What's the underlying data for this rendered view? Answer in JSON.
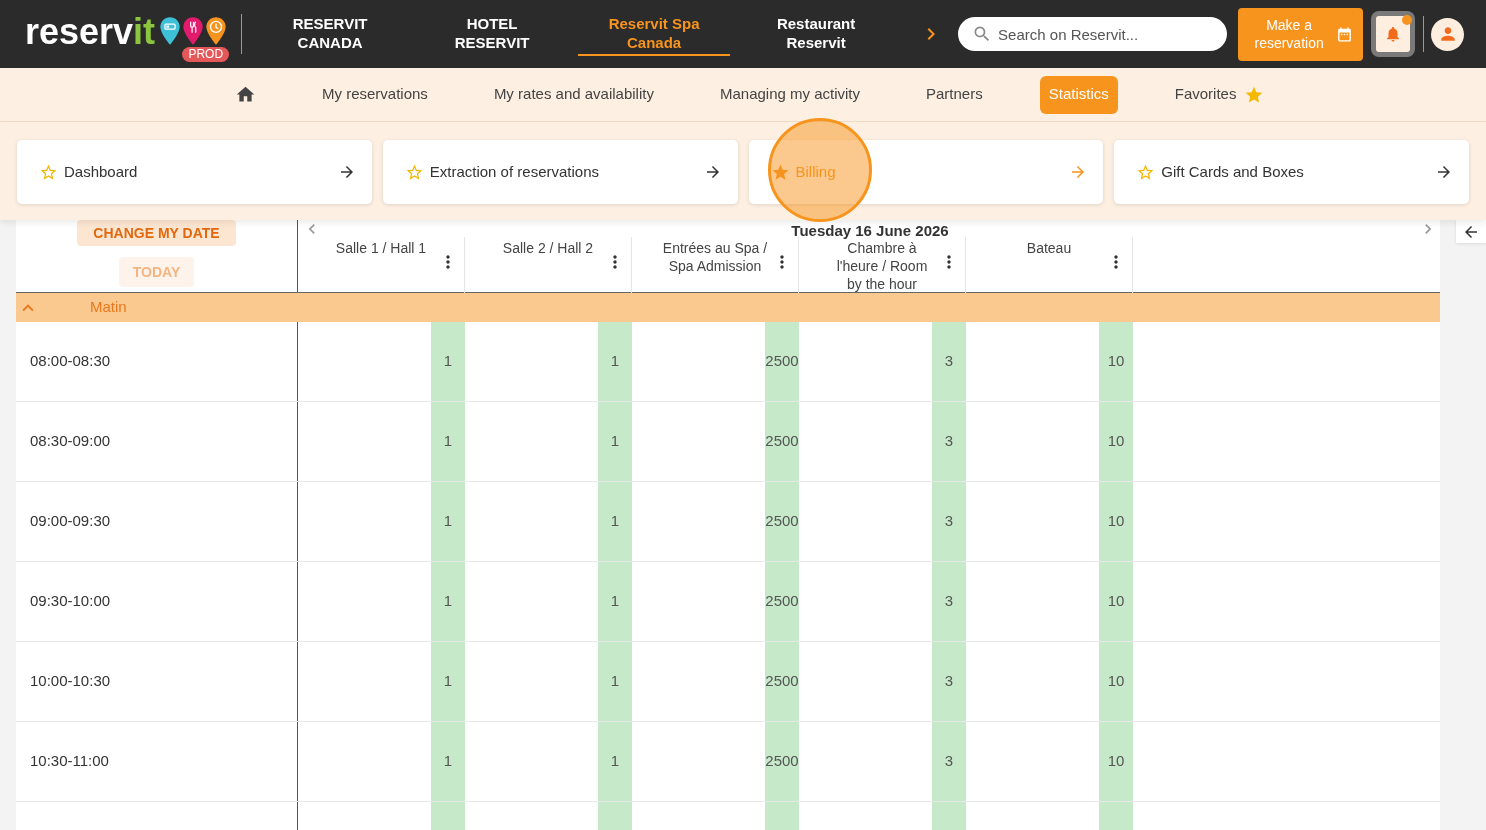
{
  "header": {
    "logo": {
      "text": "reserv",
      "accent": "it"
    },
    "environment": "PROD",
    "properties": [
      {
        "label": "RESERVIT CANADA",
        "selected": false
      },
      {
        "label": "HOTEL RESERVIT",
        "selected": false
      },
      {
        "label": "Reservit Spa Canada",
        "selected": true
      },
      {
        "label": "Restaurant Reservit",
        "selected": false
      }
    ],
    "search": {
      "placeholder": "Search on Reservit..."
    },
    "make_reservation": "Make a reservation",
    "notifications": {
      "unread": true
    }
  },
  "menu": [
    {
      "kind": "home",
      "selected": false
    },
    {
      "kind": "link",
      "label": "My reservations",
      "selected": false
    },
    {
      "kind": "link",
      "label": "My rates and availability",
      "selected": false
    },
    {
      "kind": "link",
      "label": "Managing my activity",
      "selected": false
    },
    {
      "kind": "link",
      "label": "Partners",
      "selected": false
    },
    {
      "kind": "link",
      "label": "Statistics",
      "selected": true
    },
    {
      "kind": "favorites",
      "label": "Favorites",
      "selected": false
    }
  ],
  "shortcuts": [
    {
      "label": "Dashboard",
      "favorite": false,
      "selected": false
    },
    {
      "label": "Extraction of reservations",
      "favorite": false,
      "selected": false
    },
    {
      "label": "Billing",
      "favorite": true,
      "selected": true
    },
    {
      "label": "Gift Cards and Boxes",
      "favorite": false,
      "selected": false
    }
  ],
  "planning": {
    "change_date": "CHANGE MY DATE",
    "today": {
      "label": "TODAY",
      "disabled": true
    },
    "date": "Tuesday 16 June 2026",
    "columns": [
      "Salle 1 / Hall 1",
      "Salle 2 / Hall 2",
      "Entrées au Spa /\nSpa Admission",
      "Chambre à\nl'heure / Room\nby the hour",
      "Bateau"
    ],
    "groups": [
      {
        "label": "Matin",
        "expanded": true,
        "rows": [
          {
            "time": "08:00-08:30",
            "values": [
              "1",
              "1",
              "2500",
              "3",
              "10"
            ]
          },
          {
            "time": "08:30-09:00",
            "values": [
              "1",
              "1",
              "2500",
              "3",
              "10"
            ]
          },
          {
            "time": "09:00-09:30",
            "values": [
              "1",
              "1",
              "2500",
              "3",
              "10"
            ]
          },
          {
            "time": "09:30-10:00",
            "values": [
              "1",
              "1",
              "2500",
              "3",
              "10"
            ]
          },
          {
            "time": "10:00-10:30",
            "values": [
              "1",
              "1",
              "2500",
              "3",
              "10"
            ]
          },
          {
            "time": "10:30-11:00",
            "values": [
              "1",
              "1",
              "2500",
              "3",
              "10"
            ]
          }
        ]
      }
    ]
  }
}
